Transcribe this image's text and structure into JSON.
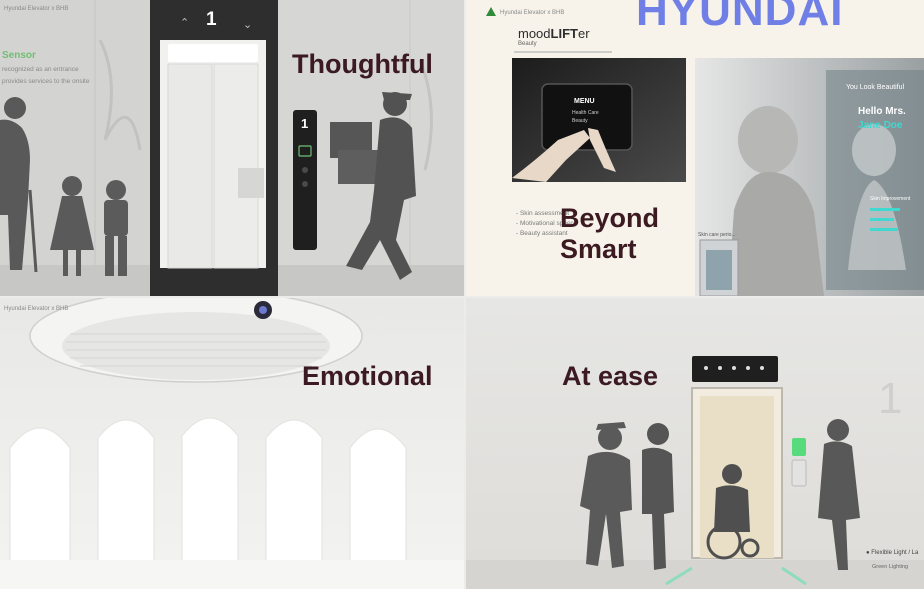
{
  "brand": {
    "text": "HYUNDAI"
  },
  "panels": {
    "thoughtful": {
      "caption": "Thoughtful",
      "header_tiny": "Hyundai Elevator x BHB",
      "sensor_title": "Sensor",
      "sensor_line1": "recognized as an entrance",
      "sensor_line2": "provides services to the onsite",
      "floor_number": "1",
      "panel_number": "1"
    },
    "beyond_smart": {
      "caption_line1": "Beyond",
      "caption_line2": "Smart",
      "header_tiny": "Hyundai Elevator x BHB",
      "app_title_a": "mood",
      "app_title_b": "LIFT",
      "app_title_c": "er",
      "app_subtitle": "Beauty",
      "menu_title": "MENU",
      "menu_item1": "Health Care",
      "menu_item2": "Beauty",
      "features": [
        "- Skin assessment",
        "- Motivational speech",
        "- Beauty assistant"
      ],
      "mirror_line1": "You Look Beautiful",
      "mirror_line2": "Hello Mrs.",
      "mirror_line3": "Jane Doe",
      "mirror_small": "Skin Improvement",
      "thumb_label": "Skin care perio..."
    },
    "emotional": {
      "caption": "Emotional",
      "header_tiny": "Hyundai Elevator x BHB"
    },
    "at_ease": {
      "caption": "At ease",
      "floor_number": "1",
      "legend_line1": "Flexible Light / La",
      "legend_line2": "Green Lighting"
    }
  },
  "colors": {
    "caption": "#3b1a22",
    "brand": "#6f7fe6",
    "sensor_green": "#6fbf73",
    "mirror_accent": "#3fd9d0"
  }
}
